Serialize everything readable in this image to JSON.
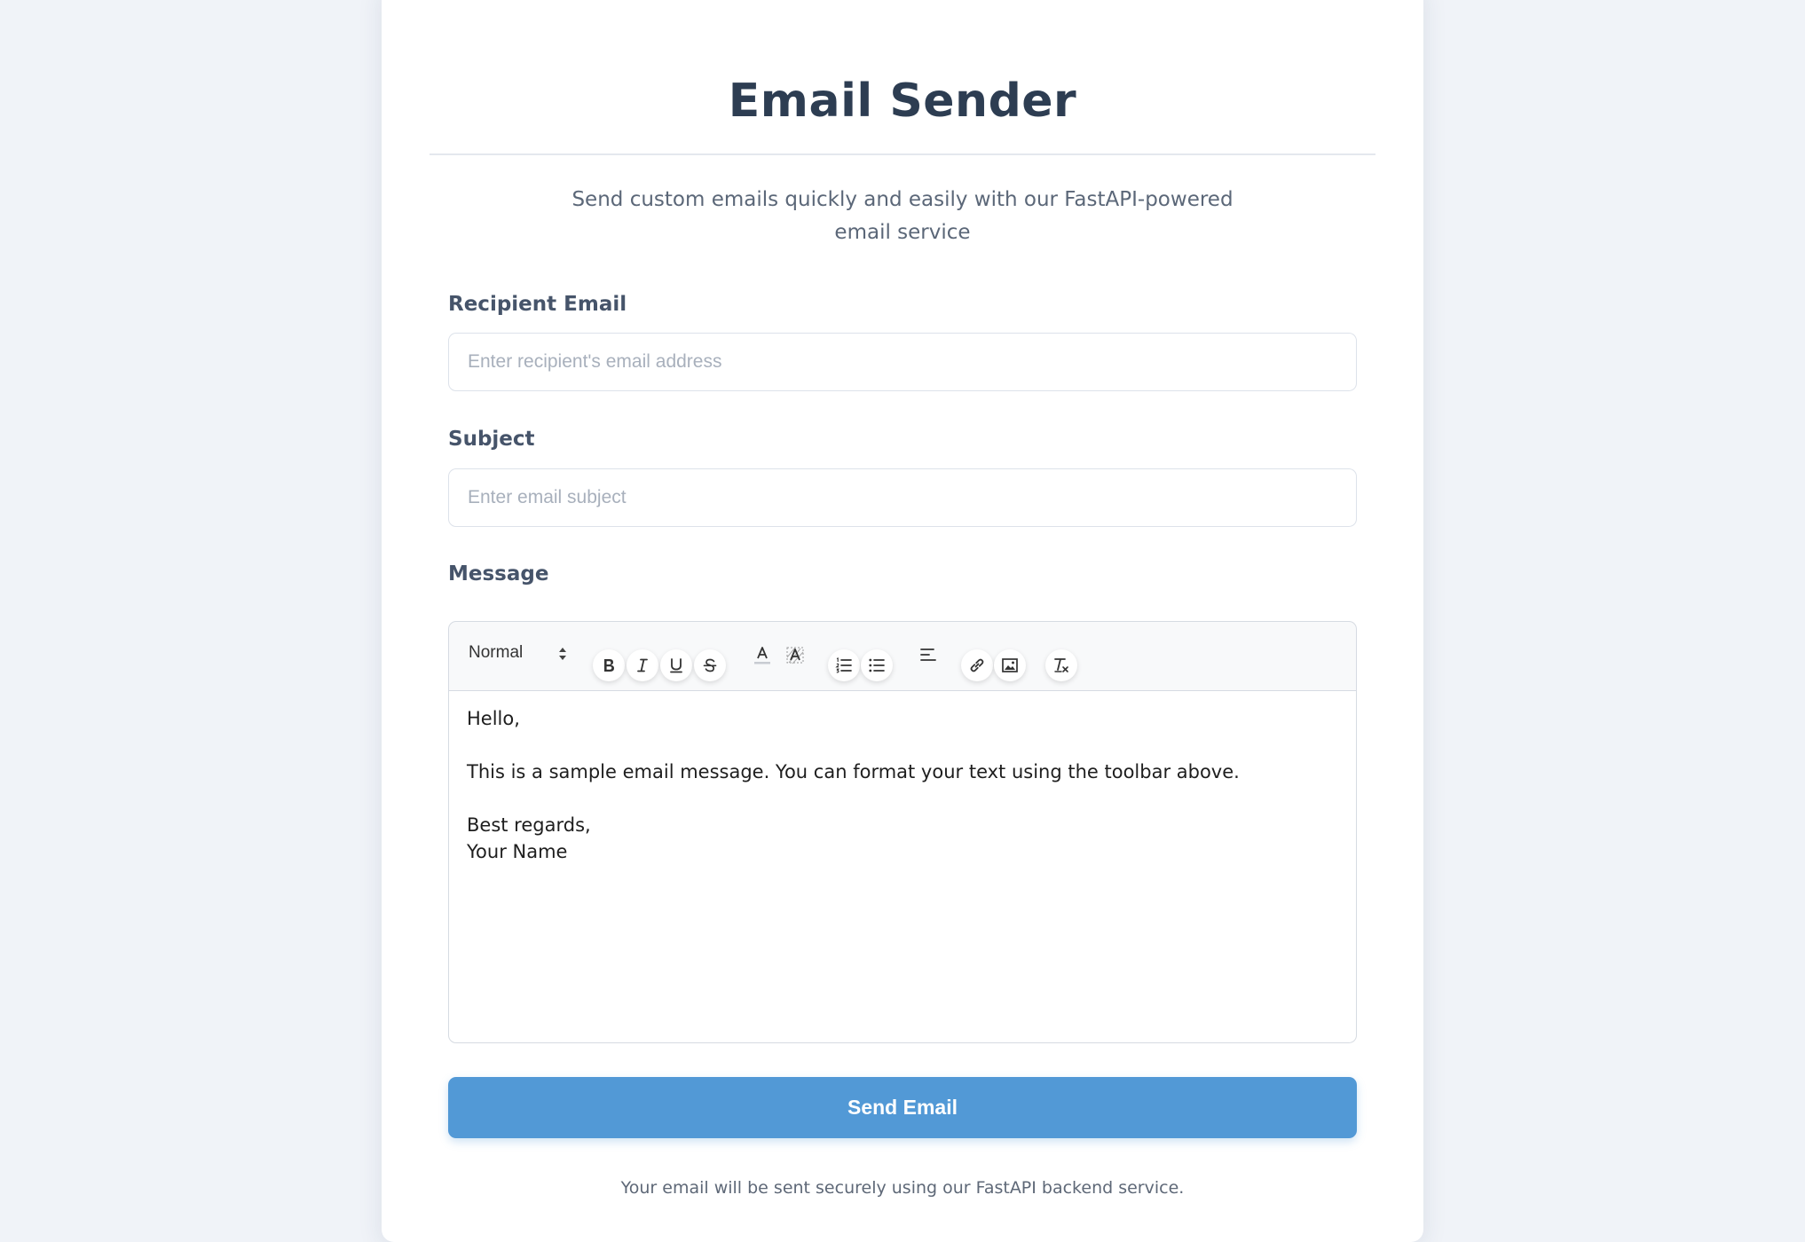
{
  "app": {
    "title": "Email Sender",
    "subtitle": "Send custom emails quickly and easily with our FastAPI-powered email service"
  },
  "form": {
    "recipient": {
      "label": "Recipient Email",
      "placeholder": "Enter recipient's email address",
      "value": ""
    },
    "subject": {
      "label": "Subject",
      "placeholder": "Enter email subject",
      "value": ""
    },
    "message": {
      "label": "Message",
      "toolbar": {
        "header_select": "Normal",
        "buttons": [
          {
            "icon": "bold-icon"
          },
          {
            "icon": "italic-icon"
          },
          {
            "icon": "underline-icon"
          },
          {
            "icon": "strikethrough-icon"
          },
          {
            "icon": "text-color-icon"
          },
          {
            "icon": "background-color-icon"
          },
          {
            "icon": "ordered-list-icon"
          },
          {
            "icon": "bullet-list-icon"
          },
          {
            "icon": "align-left-icon"
          },
          {
            "icon": "link-icon"
          },
          {
            "icon": "image-icon"
          },
          {
            "icon": "clear-format-icon"
          }
        ]
      },
      "lines": [
        "Hello,",
        "",
        "This is a sample email message. You can format your text using the toolbar above.",
        "",
        "Best regards,",
        "Your Name"
      ]
    },
    "submit_label": "Send Email"
  },
  "footer": {
    "note": "Your email will be sent securely using our FastAPI backend service."
  },
  "colors": {
    "page_background": "#f0f3f8",
    "card_background": "#ffffff",
    "title": "#2d3d52",
    "button": "#5299d6"
  }
}
